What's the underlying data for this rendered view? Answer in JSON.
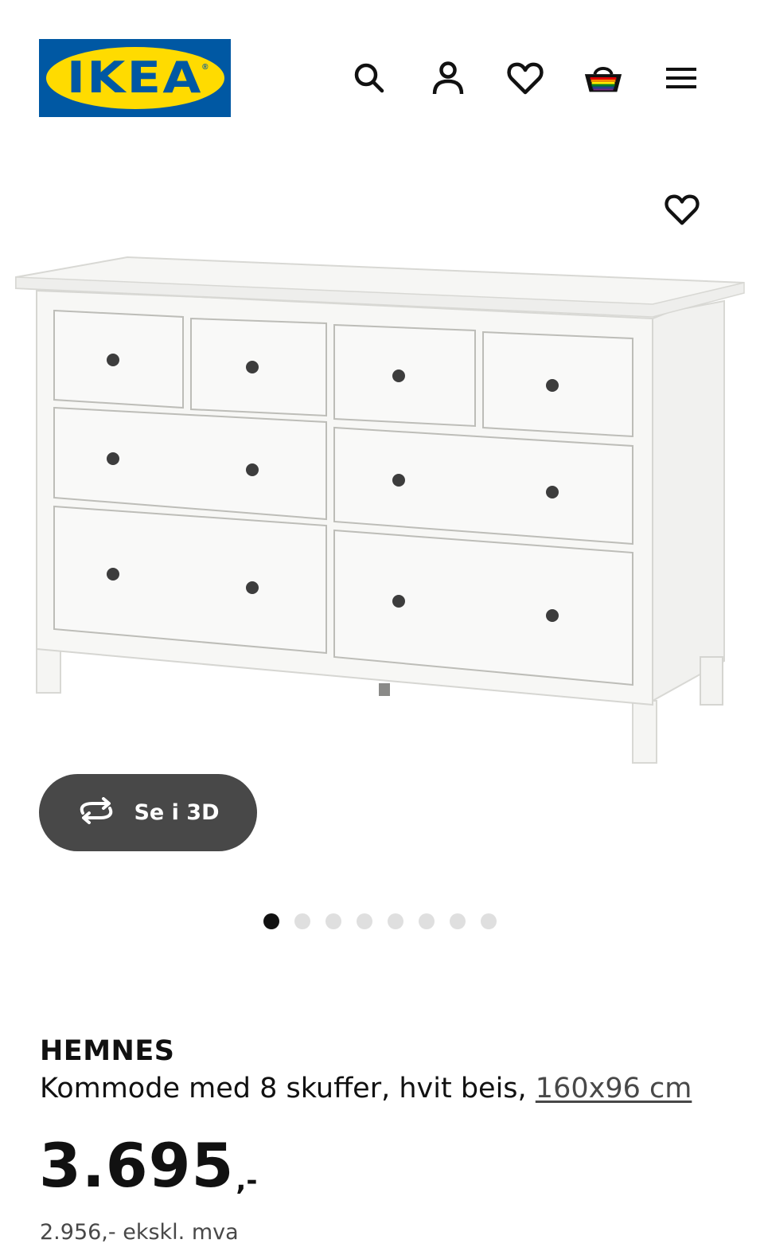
{
  "header": {
    "logo_text": "IKEA",
    "logo_registered": "®",
    "icons": [
      "search-icon",
      "user-icon",
      "heart-icon",
      "basket-icon",
      "menu-icon"
    ]
  },
  "gallery": {
    "see_3d_label": "Se i 3D",
    "dot_count": 8,
    "active_dot": 1
  },
  "product": {
    "name": "HEMNES",
    "description": "Kommode med 8 skuffer, hvit beis, ",
    "size_link": "160x96 cm",
    "price": "3.695",
    "price_suffix": ",-",
    "price_ex_vat": "2.956,- ekskl. mva"
  },
  "colors": {
    "ikea_blue": "#0058a3",
    "ikea_yellow": "#ffdb00",
    "button_dark": "#484848",
    "dot_inactive": "#dfdfdf",
    "dot_active": "#111111"
  }
}
